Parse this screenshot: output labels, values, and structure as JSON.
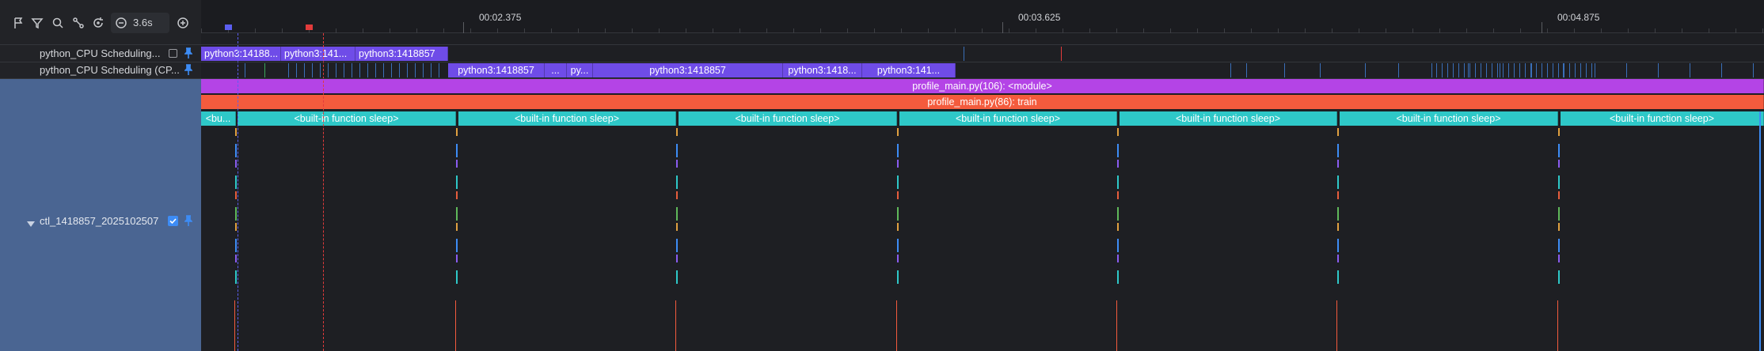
{
  "toolbar": {
    "zoom_value": "3.6s",
    "icons": [
      "flag-icon",
      "filter-icon",
      "search-icon",
      "link-icon",
      "reset-icon",
      "zoom-out-icon",
      "zoom-in-icon"
    ]
  },
  "ruler": {
    "ticks": [
      "00:02.375",
      "00:03.625",
      "00:04.875"
    ]
  },
  "tracks": {
    "track1": {
      "label": "python_CPU Scheduling..."
    },
    "track2": {
      "label": "python_CPU Scheduling (CP..."
    },
    "track3": {
      "label": "ctl_1418857_2025102507..."
    }
  },
  "track1_slices": [
    "python3:1418857",
    "python3:1418857",
    "python3:1418857"
  ],
  "track1_display": [
    "python3:14188...",
    "python3:141...",
    "python3:1418857"
  ],
  "track2_display": [
    "python3:1418857",
    "...",
    "py...",
    "python3:1418857",
    "python3:1418...",
    "python3:141..."
  ],
  "module_slice": "profile_main.py(106): <module>",
  "train_slice": "profile_main.py(86): train",
  "sleep_label": "<built-in function sleep>",
  "sleep_short": "<bu...",
  "colors": {
    "track_purple": "#6f4ce8",
    "module_magenta": "#b444e6",
    "train_orange": "#f45b3d",
    "sleep_cyan": "#2ec8c8",
    "selection_blue": "#4a6592",
    "marker_blue": "#5b5ef0",
    "marker_red": "#e23b3b"
  }
}
